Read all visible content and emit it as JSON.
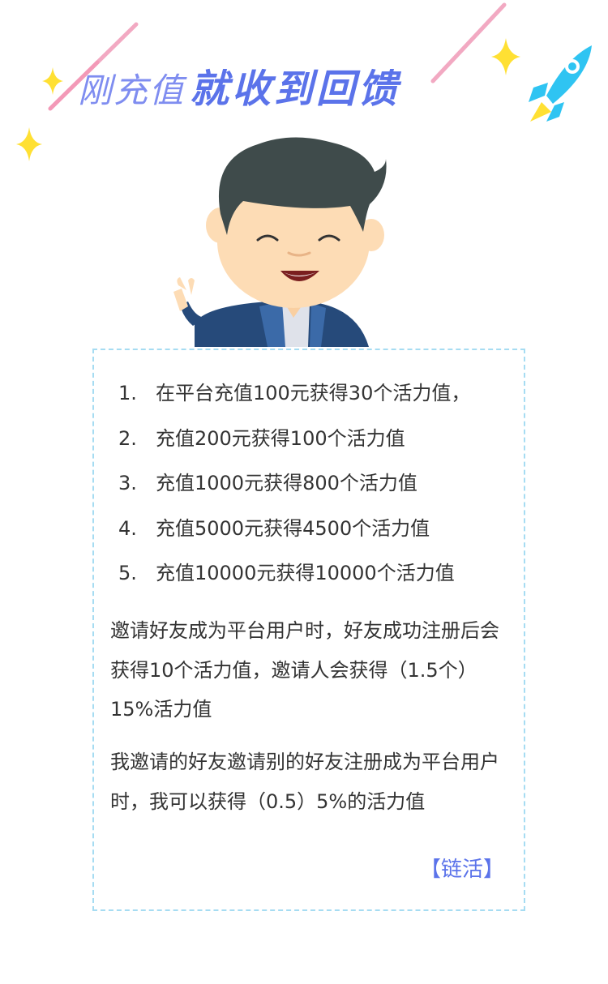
{
  "title": {
    "light": "刚充值",
    "bold": "就收到回馈"
  },
  "rewards": [
    {
      "num": "1.",
      "text": "在平台充值100元获得30个活力值，"
    },
    {
      "num": "2.",
      "text": "充值200元获得100个活力值"
    },
    {
      "num": "3.",
      "text": "充值1000元获得800个活力值"
    },
    {
      "num": "4.",
      "text": "充值5000元获得4500个活力值"
    },
    {
      "num": "5.",
      "text": "充值10000元获得10000个活力值"
    }
  ],
  "invite_rule": "邀请好友成为平台用户时，好友成功注册后会获得10个活力值，邀请人会获得（1.5个）15%活力值",
  "second_level_rule": "我邀请的好友邀请别的好友注册成为平台用户时，我可以获得（0.5）5%的活力值",
  "link_label": "【链活】",
  "colors": {
    "title_light": "#7f8df0",
    "title_bold": "#5b73ea",
    "card_border": "#a6dcf2",
    "sparkle": "#ffe033",
    "rocket": "#2fc4f2",
    "streak": "#f0a6c0"
  },
  "icons": [
    "sparkle-icon",
    "rocket-icon",
    "cartoon-man-illustration"
  ]
}
